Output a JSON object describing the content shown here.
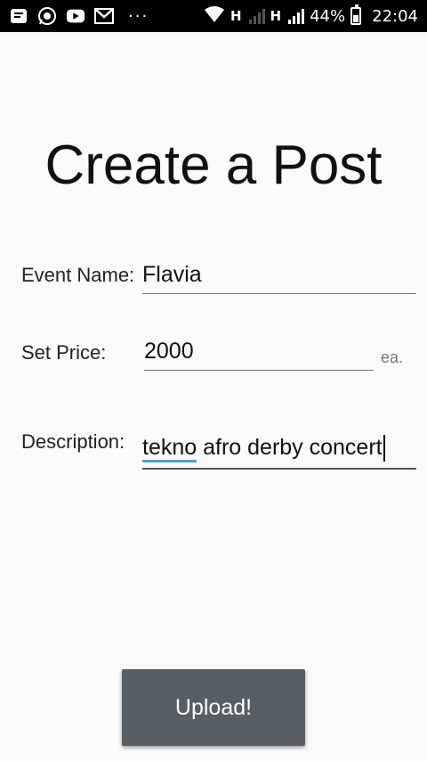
{
  "status_bar": {
    "battery": "44%",
    "time": "22:04",
    "network_1": "H",
    "network_2": "H",
    "more_dots": "···"
  },
  "page": {
    "title": "Create a Post"
  },
  "form": {
    "event_name_label": "Event Name:",
    "event_name_value": "Flavia",
    "price_label": "Set Price:",
    "price_value": "2000",
    "price_suffix": "ea.",
    "description_label": "Description:",
    "description_value_word1": "tekno",
    "description_value_rest": " afro derby concert"
  },
  "actions": {
    "upload_label": "Upload!"
  }
}
